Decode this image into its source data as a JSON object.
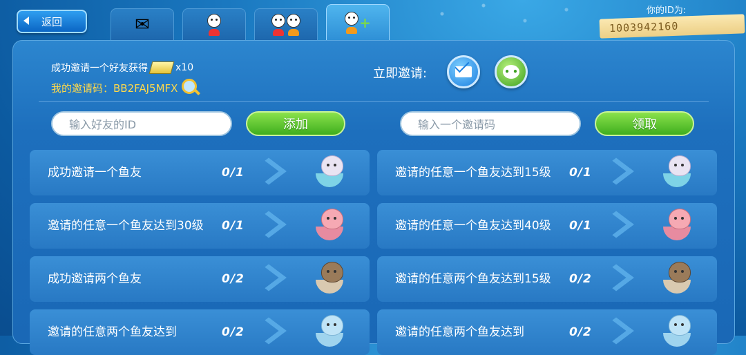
{
  "header": {
    "back_label": "返回",
    "tabs": [
      {
        "name": "mail",
        "active": false
      },
      {
        "name": "single-friend",
        "active": false
      },
      {
        "name": "two-friends",
        "active": false
      },
      {
        "name": "add-friend",
        "active": true
      }
    ],
    "id_label": "你的ID为:",
    "id_value": "1003942160"
  },
  "invite": {
    "reward_text": "成功邀请一个好友获得",
    "reward_count": "x10",
    "code_text": "我的邀请码：BB2FAJ5MFX",
    "invite_now": "立即邀请:"
  },
  "forms": {
    "friend_id_placeholder": "输入好友的ID",
    "add_label": "添加",
    "invite_code_placeholder": "输入一个邀请码",
    "claim_label": "领取"
  },
  "tasks": [
    {
      "label": "成功邀请一个鱼友",
      "progress": "0/1",
      "fish": "lavender"
    },
    {
      "label": "邀请的任意一个鱼友达到15级",
      "progress": "0/1",
      "fish": "lavender"
    },
    {
      "label": "邀请的任意一个鱼友达到30级",
      "progress": "0/1",
      "fish": "pink"
    },
    {
      "label": "邀请的任意一个鱼友达到40级",
      "progress": "0/1",
      "fish": "pink"
    },
    {
      "label": "成功邀请两个鱼友",
      "progress": "0/2",
      "fish": "brown"
    },
    {
      "label": "邀请的任意两个鱼友达到15级",
      "progress": "0/2",
      "fish": "brown"
    },
    {
      "label": "邀请的任意两个鱼友达到",
      "progress": "0/2",
      "fish": "blue"
    },
    {
      "label": "邀请的任意两个鱼友达到",
      "progress": "0/2",
      "fish": "blue"
    }
  ],
  "colors": {
    "accent_green": "#3fae1e",
    "code_yellow": "#ffd94a",
    "panel_blue": "#1d6fbd"
  }
}
